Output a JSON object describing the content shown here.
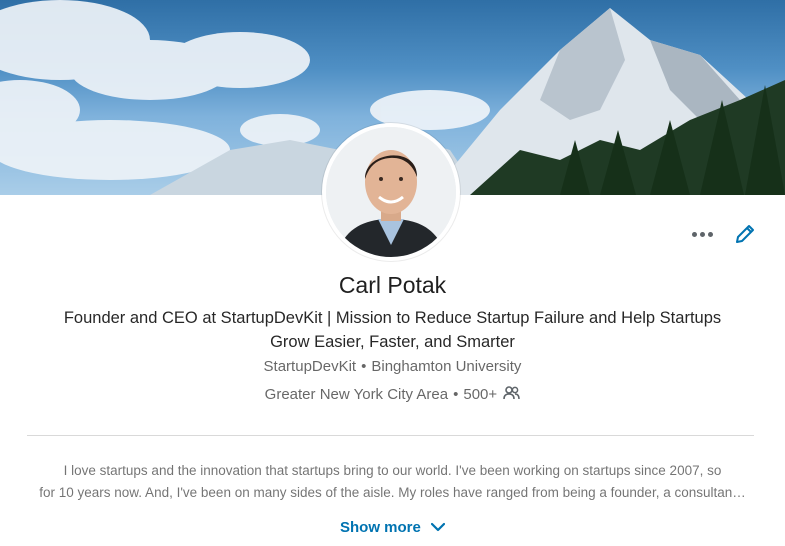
{
  "profile": {
    "name": "Carl Potak",
    "headline": "Founder and CEO at StartupDevKit | Mission to Reduce Startup Failure and Help Startups Grow Easier, Faster, and Smarter",
    "company": "StartupDevKit",
    "school": "Binghamton University",
    "location": "Greater New York City Area",
    "connections": "500+",
    "separator": "•"
  },
  "summary": {
    "line1": "I love startups and the innovation that startups bring to our world. I've been working on startups since 2007, so",
    "line2": "for 10 years now. And, I've been on many sides of the aisle. My roles have ranged from being a founder, a consultan…",
    "show_more_label": "Show more"
  },
  "icons": {
    "more": "more-horizontal-icon",
    "edit": "pencil-icon",
    "connections": "people-icon",
    "expand": "chevron-down-icon"
  },
  "colors": {
    "accent": "#0073b1",
    "muted_icon": "#5e6469"
  }
}
